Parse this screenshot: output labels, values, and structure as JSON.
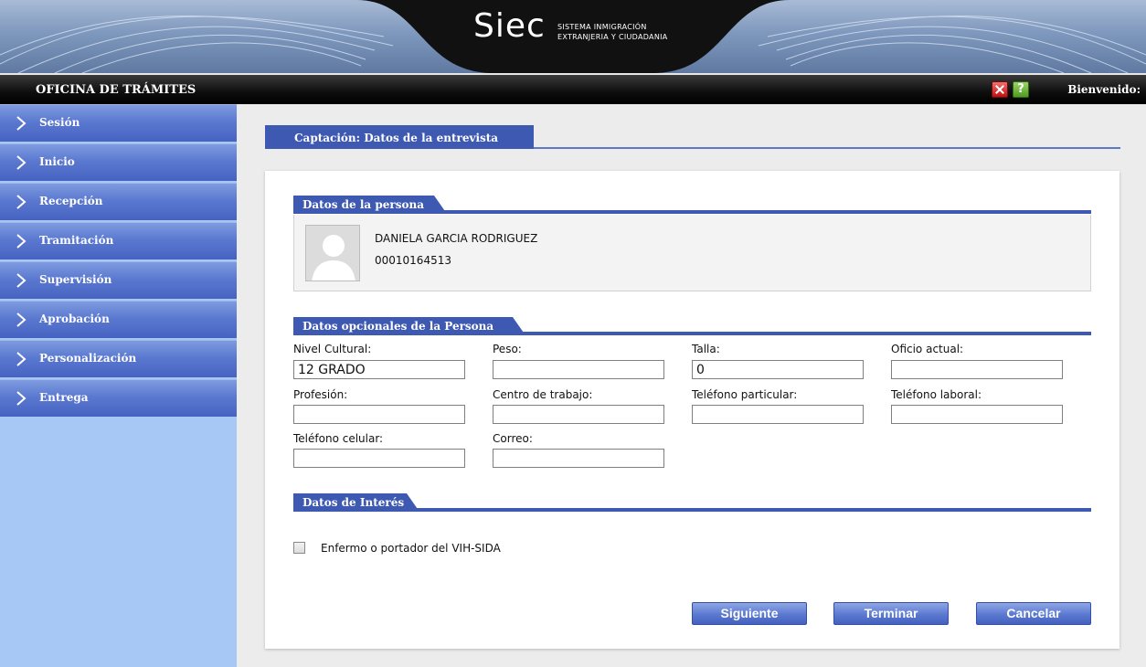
{
  "header": {
    "logo": "Siec",
    "subtitle_line1": "SISTEMA INMIGRACIÓN",
    "subtitle_line2": "EXTRANJERIA Y CIUDADANIA"
  },
  "topbar": {
    "office": "OFICINA DE TRÁMITES",
    "welcome": "Bienvenido:",
    "icons": [
      "close-icon",
      "help-icon"
    ],
    "help_glyph": "?"
  },
  "sidebar": {
    "items": [
      {
        "label": "Sesión"
      },
      {
        "label": "Inicio"
      },
      {
        "label": "Recepción"
      },
      {
        "label": "Tramitación"
      },
      {
        "label": "Supervisión"
      },
      {
        "label": "Aprobación"
      },
      {
        "label": "Personalización"
      },
      {
        "label": "Entrega"
      }
    ]
  },
  "page": {
    "tab": "Captación: Datos de la entrevista"
  },
  "persona": {
    "section_title": "Datos de la persona",
    "name": "DANIELA GARCIA RODRIGUEZ",
    "id": "00010164513"
  },
  "opcionales": {
    "section_title": "Datos opcionales de la Persona",
    "fields": [
      {
        "label": "Nivel Cultural:",
        "value": "12 GRADO"
      },
      {
        "label": "Peso:",
        "value": ""
      },
      {
        "label": "Talla:",
        "value": "0"
      },
      {
        "label": "Oficio actual:",
        "value": ""
      },
      {
        "label": "Profesión:",
        "value": ""
      },
      {
        "label": "Centro de trabajo:",
        "value": ""
      },
      {
        "label": "Teléfono particular:",
        "value": ""
      },
      {
        "label": "Teléfono laboral:",
        "value": ""
      },
      {
        "label": "Teléfono celular:",
        "value": ""
      },
      {
        "label": "Correo:",
        "value": ""
      }
    ]
  },
  "interes": {
    "section_title": "Datos de Interés",
    "checkbox_label": "Enfermo o portador del VIH-SIDA",
    "checked": false
  },
  "actions": {
    "next": "Siguiente",
    "finish": "Terminar",
    "cancel": "Cancelar"
  },
  "colors": {
    "primary_blue": "#3d59b2",
    "sidebar_bg": "#a7c7f5",
    "topbar": "#000000"
  }
}
